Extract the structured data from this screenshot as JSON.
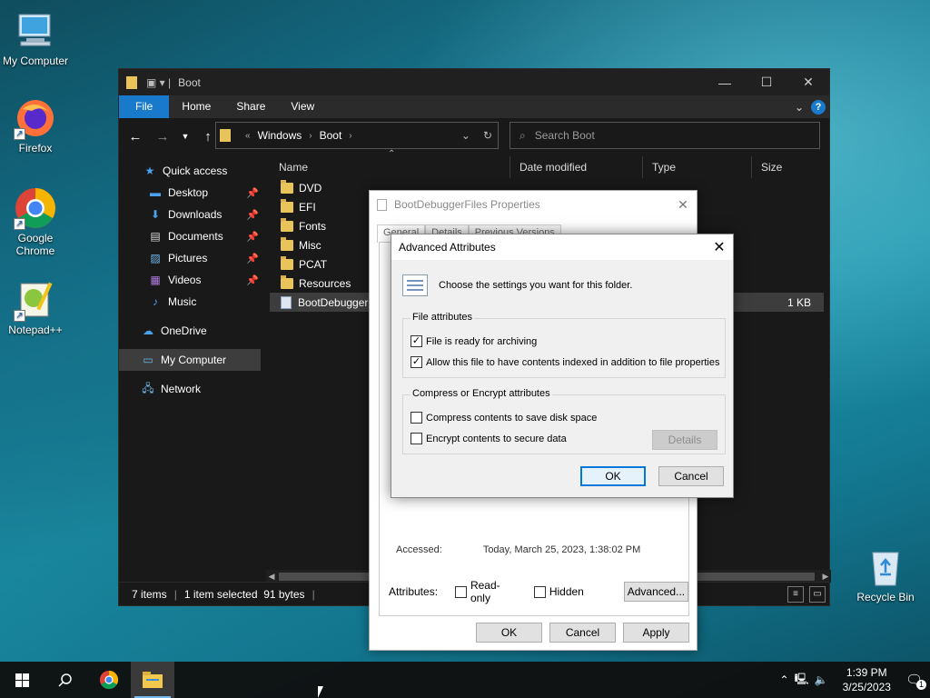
{
  "desktop": {
    "icons": [
      {
        "label": "My Computer"
      },
      {
        "label": "Firefox"
      },
      {
        "label": "Google Chrome"
      },
      {
        "label": "Notepad++"
      },
      {
        "label": "Recycle Bin"
      }
    ]
  },
  "explorer": {
    "title": "Boot",
    "ribbon_tabs": [
      "File",
      "Home",
      "Share",
      "View"
    ],
    "breadcrumb": [
      "Windows",
      "Boot"
    ],
    "search_placeholder": "Search Boot",
    "sidebar": [
      {
        "label": "Quick access",
        "icon": "star-icon"
      },
      {
        "label": "Desktop",
        "icon": "desktop-icon",
        "pinned": true
      },
      {
        "label": "Downloads",
        "icon": "download-icon",
        "pinned": true
      },
      {
        "label": "Documents",
        "icon": "documents-icon",
        "pinned": true
      },
      {
        "label": "Pictures",
        "icon": "pictures-icon",
        "pinned": true
      },
      {
        "label": "Videos",
        "icon": "videos-icon",
        "pinned": true
      },
      {
        "label": "Music",
        "icon": "music-icon"
      },
      {
        "label": "OneDrive",
        "icon": "cloud-icon"
      },
      {
        "label": "My Computer",
        "icon": "computer-icon",
        "selected": true
      },
      {
        "label": "Network",
        "icon": "network-icon"
      }
    ],
    "columns": [
      "Name",
      "Date modified",
      "Type",
      "Size"
    ],
    "files": [
      {
        "name": "DVD",
        "kind": "folder",
        "size": ""
      },
      {
        "name": "EFI",
        "kind": "folder",
        "size": ""
      },
      {
        "name": "Fonts",
        "kind": "folder",
        "size": ""
      },
      {
        "name": "Misc",
        "kind": "folder",
        "size": ""
      },
      {
        "name": "PCAT",
        "kind": "folder",
        "size": ""
      },
      {
        "name": "Resources",
        "kind": "folder",
        "size": ""
      },
      {
        "name": "BootDebuggerFiles.ini",
        "kind": "file",
        "size": "1 KB",
        "selected": true
      }
    ],
    "status": {
      "items": "7 items",
      "selection": "1 item selected  91 bytes"
    }
  },
  "properties_dialog": {
    "title": "BootDebuggerFiles Properties",
    "tabs": [
      "General",
      "Details",
      "Previous Versions"
    ],
    "accessed_label": "Accessed:",
    "accessed_value": "Today, March 25, 2023, 1:38:02 PM",
    "attributes_label": "Attributes:",
    "readonly_label": "Read-only",
    "hidden_label": "Hidden",
    "advanced_button": "Advanced...",
    "ok": "OK",
    "cancel": "Cancel",
    "apply": "Apply"
  },
  "advanced_dialog": {
    "title": "Advanced Attributes",
    "instruction": "Choose the settings you want for this folder.",
    "file_attributes_legend": "File attributes",
    "archive_label": "File is ready for archiving",
    "archive_checked": true,
    "index_label": "Allow this file to have contents indexed in addition to file properties",
    "index_checked": true,
    "compress_legend": "Compress or Encrypt attributes",
    "compress_label": "Compress contents to save disk space",
    "compress_checked": false,
    "encrypt_label": "Encrypt contents to secure data",
    "encrypt_checked": false,
    "details_button": "Details",
    "ok": "OK",
    "cancel": "Cancel"
  },
  "taskbar": {
    "time": "1:39 PM",
    "date": "3/25/2023",
    "notification_count": "1"
  },
  "colors": {
    "accent": "#1979ca",
    "focus_border": "#0078d7"
  }
}
